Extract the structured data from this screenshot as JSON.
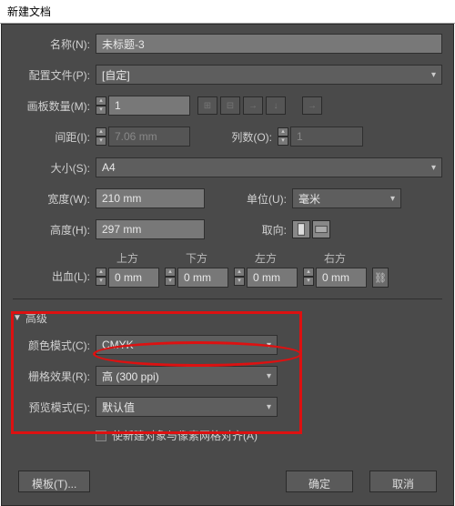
{
  "window": {
    "title": "新建文档"
  },
  "name": {
    "label": "名称(N):",
    "value": "未标题-3"
  },
  "profile": {
    "label": "配置文件(P):",
    "value": "[自定]"
  },
  "artboards": {
    "label": "画板数量(M):",
    "value": "1"
  },
  "spacing": {
    "label": "间距(I):",
    "value": "7.06 mm"
  },
  "columns": {
    "label": "列数(O):",
    "value": "1"
  },
  "size": {
    "label": "大小(S):",
    "value": "A4"
  },
  "width": {
    "label": "宽度(W):",
    "value": "210 mm"
  },
  "units": {
    "label": "单位(U):",
    "value": "毫米"
  },
  "height": {
    "label": "高度(H):",
    "value": "297 mm"
  },
  "orientation": {
    "label": "取向:"
  },
  "bleed": {
    "label": "出血(L):",
    "top": {
      "label": "上方",
      "value": "0 mm"
    },
    "bottom": {
      "label": "下方",
      "value": "0 mm"
    },
    "left": {
      "label": "左方",
      "value": "0 mm"
    },
    "right": {
      "label": "右方",
      "value": "0 mm"
    }
  },
  "advanced": {
    "title": "高级"
  },
  "colormode": {
    "label": "颜色模式(C):",
    "value": "CMYK"
  },
  "raster": {
    "label": "栅格效果(R):",
    "value": "高 (300 ppi)"
  },
  "preview": {
    "label": "预览模式(E):",
    "value": "默认值"
  },
  "pixelgrid": {
    "label": "使新建对象与像素网格对齐(A)"
  },
  "buttons": {
    "template": "模板(T)...",
    "ok": "确定",
    "cancel": "取消"
  }
}
